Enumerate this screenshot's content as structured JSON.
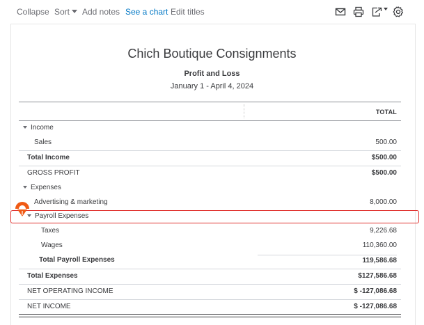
{
  "toolbar": {
    "collapse": "Collapse",
    "sort": "Sort",
    "add_notes": "Add notes",
    "see_chart": "See a chart",
    "edit_titles": "Edit titles",
    "icons": [
      "mail-icon",
      "print-icon",
      "export-icon",
      "gear-icon"
    ]
  },
  "report": {
    "company": "Chich Boutique Consignments",
    "title": "Profit and Loss",
    "date_range": "January 1 - April 4, 2024",
    "column_header": "TOTAL"
  },
  "rows": [
    {
      "label": "Income",
      "value": ""
    },
    {
      "label": "Sales",
      "value": "500.00"
    },
    {
      "label": "Total Income",
      "value": "$500.00"
    },
    {
      "label": "GROSS PROFIT",
      "value": "$500.00"
    },
    {
      "label": "Expenses",
      "value": ""
    },
    {
      "label": "Advertising & marketing",
      "value": "8,000.00"
    },
    {
      "label": "Payroll Expenses",
      "value": ""
    },
    {
      "label": "Taxes",
      "value": "9,226.68"
    },
    {
      "label": "Wages",
      "value": "110,360.00"
    },
    {
      "label": "Total Payroll Expenses",
      "value": "119,586.68"
    },
    {
      "label": "Total Expenses",
      "value": "$127,586.68"
    },
    {
      "label": "NET OPERATING INCOME",
      "value": "$ -127,086.68"
    },
    {
      "label": "NET INCOME",
      "value": "$ -127,086.68"
    }
  ],
  "colors": {
    "accent_link": "#0077c5",
    "highlight": "#e0312e",
    "cursor": "#f05a14"
  }
}
